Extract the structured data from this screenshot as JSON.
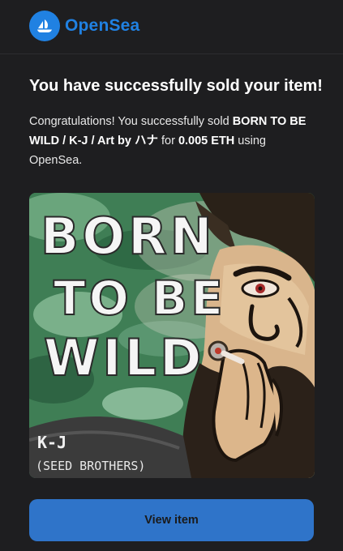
{
  "brand": {
    "name": "OpenSea",
    "accent": "#2081e2"
  },
  "email": {
    "title": "You have successfully sold your item!",
    "message_prefix": "Congratulations! You successfully sold ",
    "item_name": "BORN TO BE WILD / K-J / Art by ハナ",
    "message_middle": " for ",
    "price": "0.005 ETH",
    "message_suffix": " using OpenSea."
  },
  "artwork": {
    "line1": "BORN",
    "line2": "TO BE",
    "line3": "WILD",
    "artist": "K-J",
    "group": "(SEED BROTHERS)"
  },
  "actions": {
    "view_item_label": "View item"
  },
  "colors": {
    "background": "#1e1e20",
    "button": "#2f74c9"
  }
}
